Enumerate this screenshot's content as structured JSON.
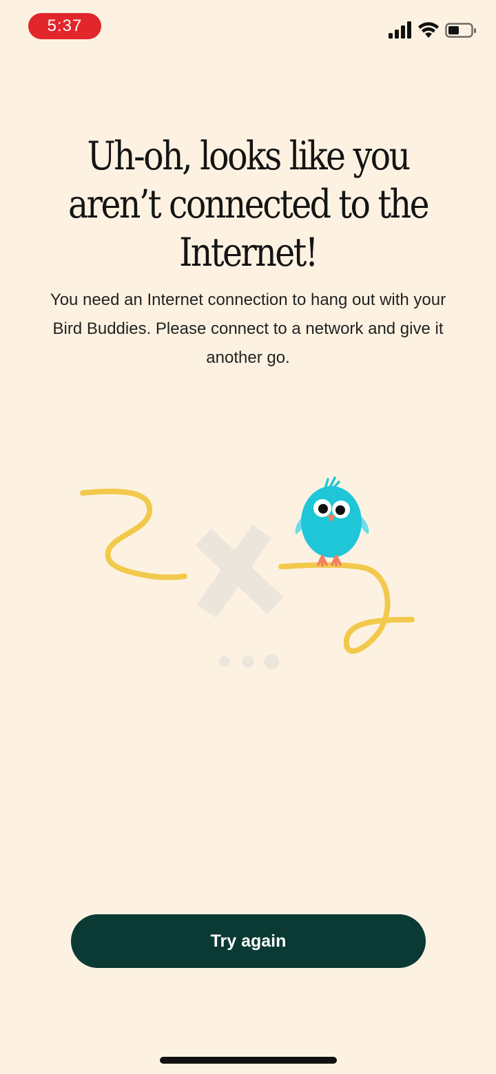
{
  "status_bar": {
    "time": "5:37",
    "icons": [
      "signal-icon",
      "wifi-icon",
      "battery-icon"
    ],
    "time_pill_color": "#e1262c"
  },
  "offline_screen": {
    "headline_lines": [
      "Uh-oh, looks like you",
      "aren’t connected to the",
      "Internet!"
    ],
    "body_lines": [
      "You need an Internet connection to hang out with your",
      "Bird Buddies. Please connect to a network and give it",
      "another go."
    ],
    "illustration": {
      "icons": [
        "broken-line-left",
        "disconnect-x-icon",
        "bird-icon",
        "broken-line-right",
        "loading-dots-icon"
      ],
      "line_color": "#f2c94c",
      "bird_color": "#1fc6d8"
    },
    "try_again_label": "Try again",
    "button_color": "#0a3a33"
  },
  "colors": {
    "background": "#fdf2e2"
  }
}
